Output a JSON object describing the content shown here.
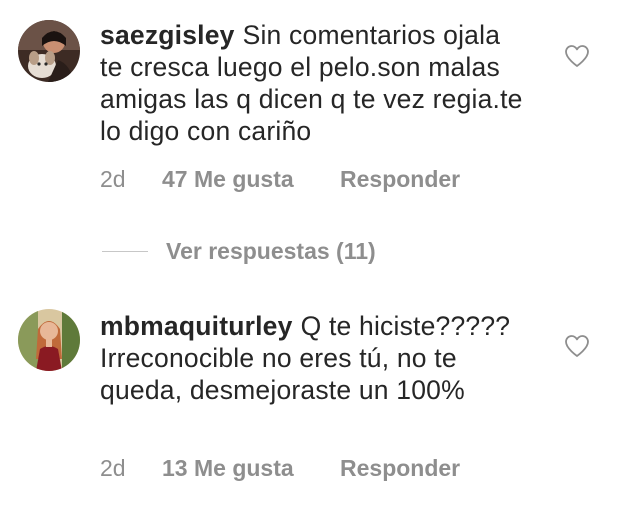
{
  "comments": [
    {
      "username": "saezgisley",
      "text": "Sin comentarios ojala te cresca luego el pelo.son malas amigas las q dicen q te vez regia.te lo digo con cariño",
      "time": "2d",
      "likes": "47 Me gusta",
      "reply": "Responder",
      "avatar_icon": "user-avatar-with-dog",
      "like_icon": "heart-outline-icon"
    },
    {
      "username": "mbmaquiturley",
      "text": "Q te hiciste????? Irreconocible no eres tú, no te queda, desmejoraste un 100%",
      "time": "2d",
      "likes": "13 Me gusta",
      "reply": "Responder",
      "avatar_icon": "user-avatar-woman",
      "like_icon": "heart-outline-icon"
    }
  ],
  "view_replies": {
    "label": "Ver respuestas (11)"
  },
  "colors": {
    "text": "#262626",
    "secondary": "#8e8e8e",
    "divider": "#c7c7c7"
  }
}
